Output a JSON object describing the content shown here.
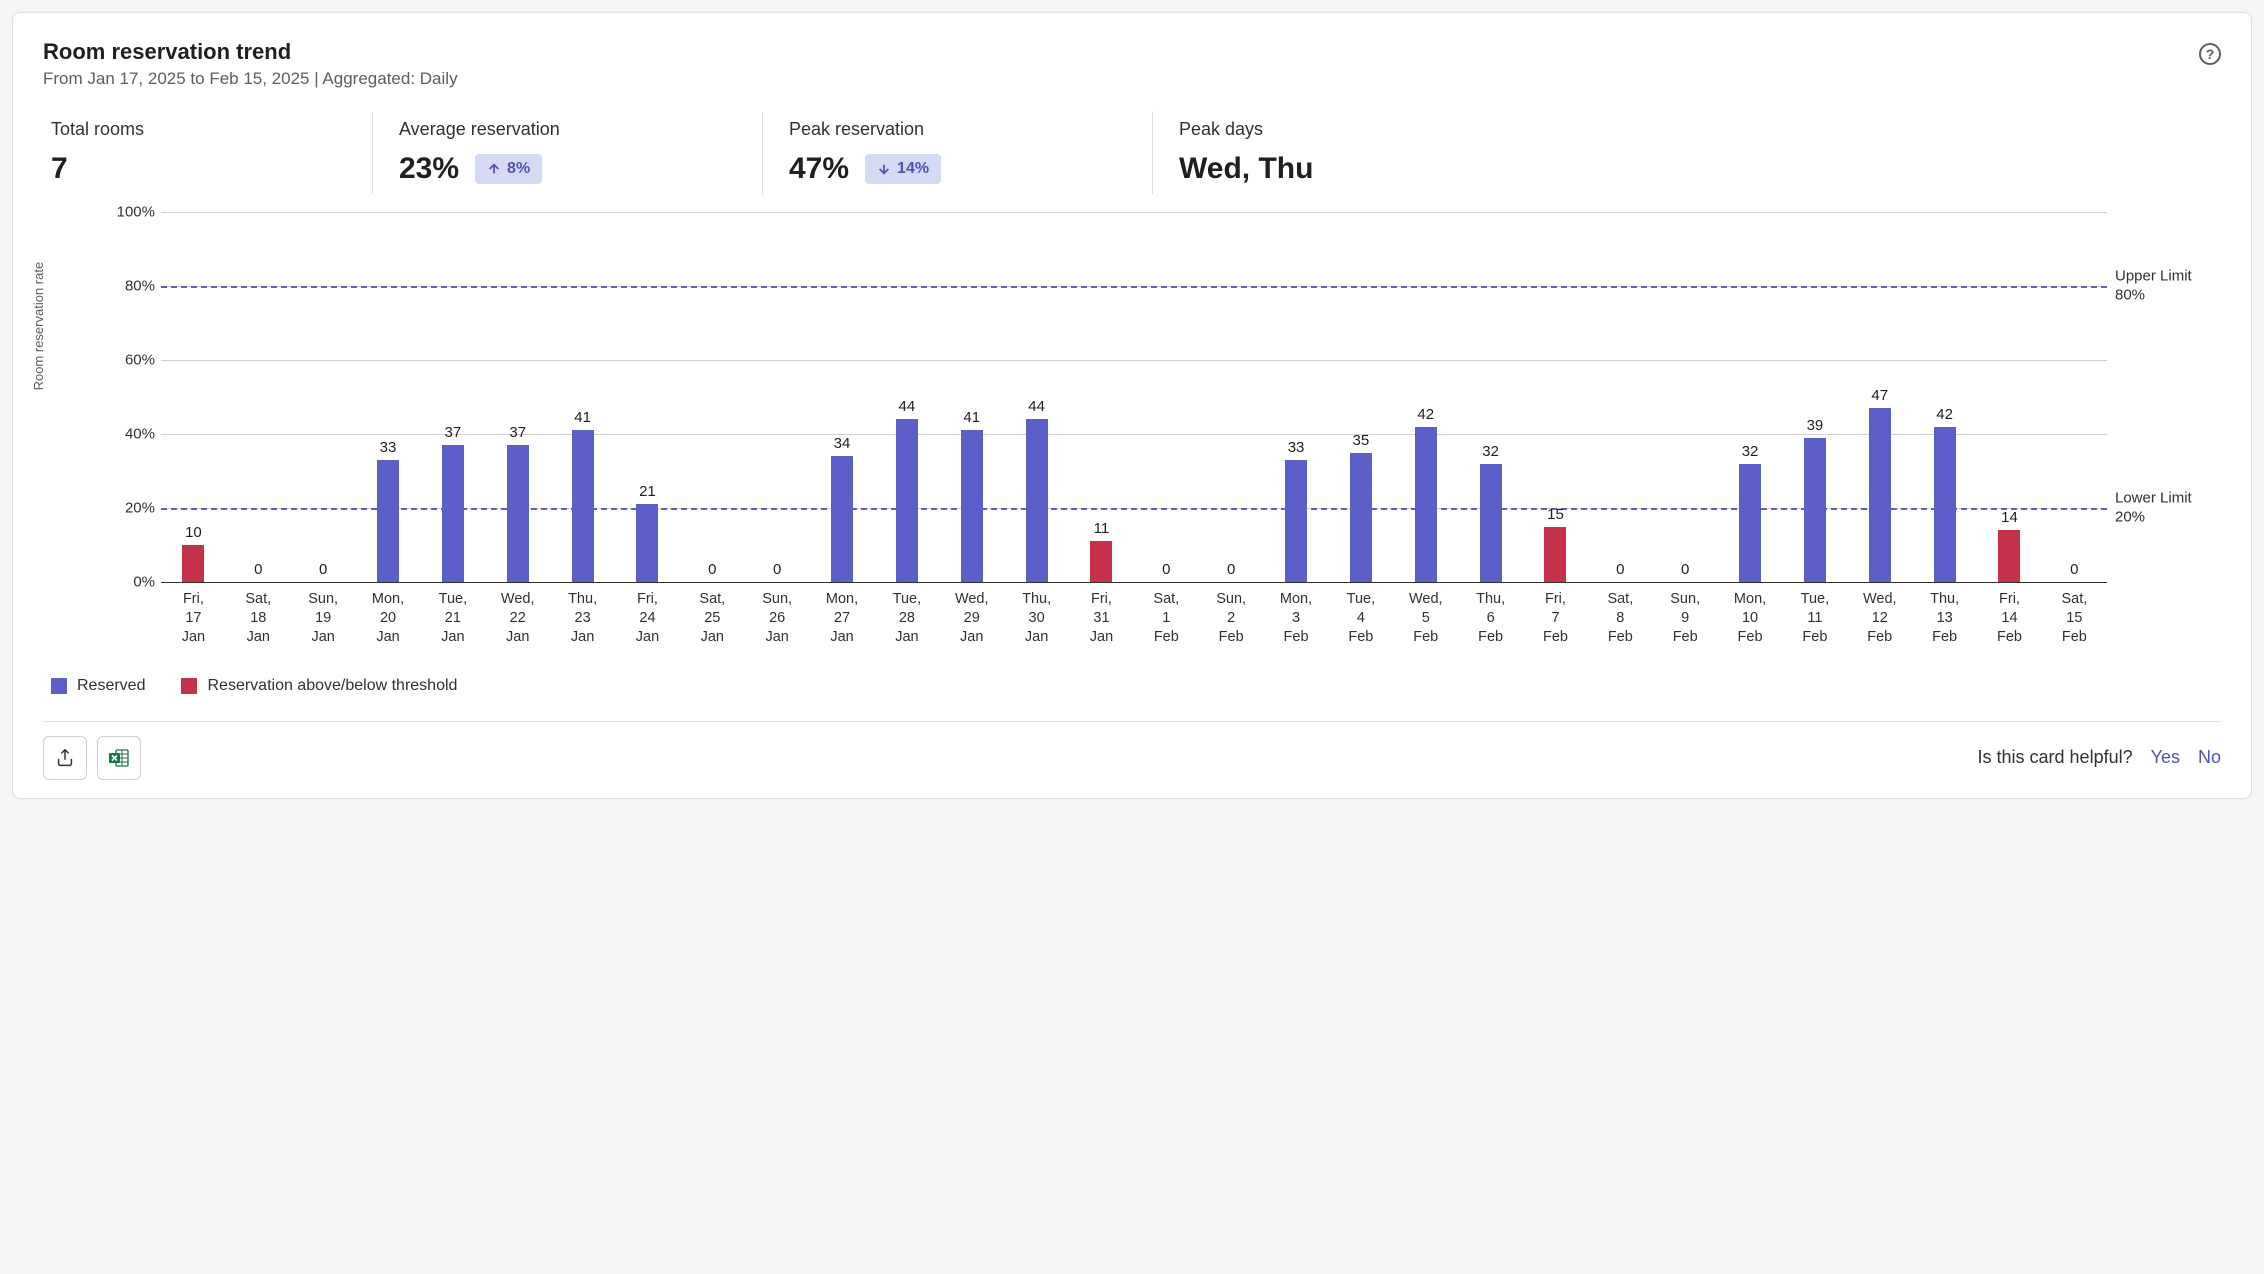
{
  "header": {
    "title": "Room reservation trend",
    "subtitle": "From Jan 17, 2025 to Feb 15, 2025 | Aggregated: Daily"
  },
  "stats": {
    "total_rooms": {
      "label": "Total rooms",
      "value": "7"
    },
    "avg_reservation": {
      "label": "Average reservation",
      "value": "23%",
      "delta": "8%",
      "direction": "up"
    },
    "peak_reservation": {
      "label": "Peak reservation",
      "value": "47%",
      "delta": "14%",
      "direction": "down"
    },
    "peak_days": {
      "label": "Peak days",
      "value": "Wed, Thu"
    }
  },
  "chart_data": {
    "type": "bar",
    "ylabel": "Room reservation rate",
    "ylim": [
      0,
      100
    ],
    "yticks": [
      0,
      20,
      40,
      60,
      80,
      100
    ],
    "upper_limit": {
      "value": 80,
      "label": "Upper Limit 80%"
    },
    "lower_limit": {
      "value": 20,
      "label": "Lower Limit 20%"
    },
    "categories": [
      "Fri, 17 Jan",
      "Sat, 18 Jan",
      "Sun, 19 Jan",
      "Mon, 20 Jan",
      "Tue, 21 Jan",
      "Wed, 22 Jan",
      "Thu, 23 Jan",
      "Fri, 24 Jan",
      "Sat, 25 Jan",
      "Sun, 26 Jan",
      "Mon, 27 Jan",
      "Tue, 28 Jan",
      "Wed, 29 Jan",
      "Thu, 30 Jan",
      "Fri, 31 Jan",
      "Sat, 1 Feb",
      "Sun, 2 Feb",
      "Mon, 3 Feb",
      "Tue, 4 Feb",
      "Wed, 5 Feb",
      "Thu, 6 Feb",
      "Fri, 7 Feb",
      "Sat, 8 Feb",
      "Sun, 9 Feb",
      "Mon, 10 Feb",
      "Tue, 11 Feb",
      "Wed, 12 Feb",
      "Thu, 13 Feb",
      "Fri, 14 Feb",
      "Sat, 15 Feb"
    ],
    "values": [
      10,
      0,
      0,
      33,
      37,
      37,
      41,
      21,
      0,
      0,
      34,
      44,
      41,
      44,
      11,
      0,
      0,
      33,
      35,
      42,
      32,
      15,
      0,
      0,
      32,
      39,
      47,
      42,
      14,
      0
    ],
    "threshold_flags": [
      true,
      false,
      false,
      false,
      false,
      false,
      false,
      false,
      false,
      false,
      false,
      false,
      false,
      false,
      true,
      false,
      false,
      false,
      false,
      false,
      false,
      true,
      false,
      false,
      false,
      false,
      false,
      false,
      true,
      false
    ],
    "legend": {
      "reserved": "Reserved",
      "threshold": "Reservation above/below threshold"
    }
  },
  "footer": {
    "question": "Is this card helpful?",
    "yes": "Yes",
    "no": "No"
  }
}
